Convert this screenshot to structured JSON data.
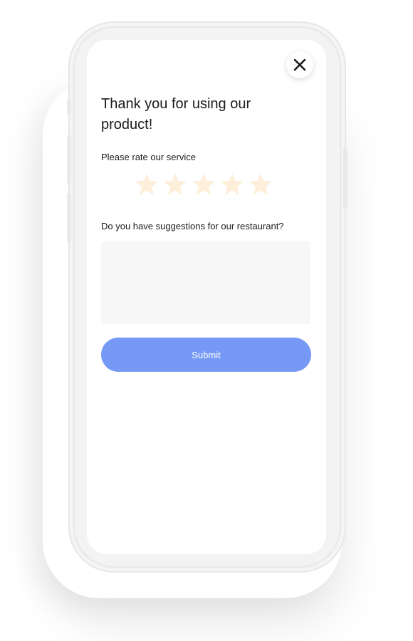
{
  "dialog": {
    "title": "Thank you for using our product!",
    "rating_label": "Please rate our service",
    "rating": {
      "value": 0,
      "max": 5,
      "star_color": "#fdefd9",
      "icon": "star-icon"
    },
    "suggestions_label": "Do you have suggestions for our restaurant?",
    "suggestions_value": "",
    "submit_label": "Submit",
    "close_icon": "close-icon"
  },
  "colors": {
    "accent": "#7599f5",
    "star": "#fdefd9",
    "textarea_bg": "#f7f7f7",
    "text": "#1b1b1b"
  }
}
